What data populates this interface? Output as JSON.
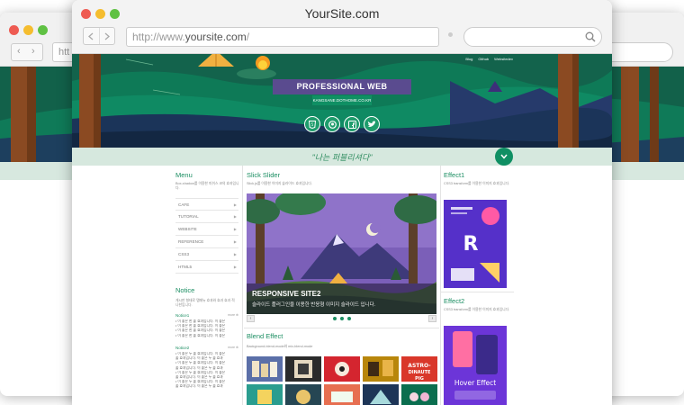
{
  "window": {
    "title": "YourSite.com",
    "url_prefix": "http://www.",
    "url_domain": "yoursite.com",
    "url_suffix": "/",
    "back_url_text": "htt"
  },
  "colors": {
    "brand_green": "#1b8e62",
    "title_badge": "#5a4b8f",
    "strip_bg": "#d6e8de",
    "traffic_red": "#ee5b52",
    "traffic_yellow": "#f5bd2f",
    "traffic_green": "#5fc143"
  },
  "hero": {
    "nav": [
      "Blog",
      "Github",
      "Websitedev"
    ],
    "title": "PROFESSIONAL WEB PUBLISHER",
    "subtitle": "KANGSANE.DOTHOME.CO.KR",
    "icons": [
      "html5-icon",
      "github-icon",
      "facebook-icon",
      "twitter-icon"
    ]
  },
  "strip": {
    "slogan": "\"나는 퍼블리셔다\""
  },
  "menu": {
    "title": "Menu",
    "desc": "Box-shadow를 이용한 미쉬스 코의 효과입니다.",
    "items": [
      "CAFE",
      "TUTORIAL",
      "WEBSITE",
      "REFERENCE",
      "CSS3",
      "HTML5"
    ]
  },
  "notice": {
    "title": "Notice",
    "desc": "게시판 형태로 탭메뉴 효과와 효과 효과 적 나한입니다.",
    "groups": [
      {
        "label": "Notice1",
        "more": "more ⊕",
        "lines": [
          "• 이 좋은 한 줄 효과입니다. 이 좋은",
          "• 이 좋은 한 줄 효과입니다. 이 좋은",
          "• 이 좋은 한 줄 효과입니다. 이 좋은",
          "• 이 좋은 한 줄 효과입니다. 이 좋은"
        ]
      },
      {
        "label": "Notice2",
        "more": "more ⊕",
        "lines": [
          "• 이 좋은 두 줄 효과입니다. 이 좋은",
          "  줄 효과입니다. 이 좋은 두 줄 효과",
          "• 이 좋은 두 줄 효과입니다. 이 좋은",
          "  줄 효과입니다. 이 좋은 두 줄 효과",
          "• 이 좋은 두 줄 효과입니다. 이 좋은",
          "  줄 효과입니다. 이 좋은 두 줄 효과",
          "• 이 좋은 두 줄 효과입니다. 이 좋은",
          "  줄 효과입니다. 이 좋은 두 줄 효과"
        ]
      }
    ]
  },
  "slider": {
    "title": "Slick Slider",
    "desc": "Slick.js를 이용한 이미지 슬라이드 효과입니다.",
    "caption_title": "RESPONSIVE SITE2",
    "caption_desc": "슬라이드 플러그인을 이용한 반응형 이미지 슬라이드 입니다.",
    "prev": "‹",
    "next": "›",
    "dots": 3
  },
  "blend": {
    "title": "Blend Effect",
    "desc": "Background-blend-mode와 mix-blend-mode",
    "thumb_labels": [
      "ASTRO-DINAUTE PIG"
    ]
  },
  "effect1": {
    "title": "Effect1",
    "desc": "CSS3 transform를 이용한 이미지 효과입니다.",
    "card_text": "R"
  },
  "effect2": {
    "title": "Effect2",
    "desc": "CSS3 transform를 이용한 이미지 효과입니다.",
    "card_text": "Hover Effect"
  }
}
